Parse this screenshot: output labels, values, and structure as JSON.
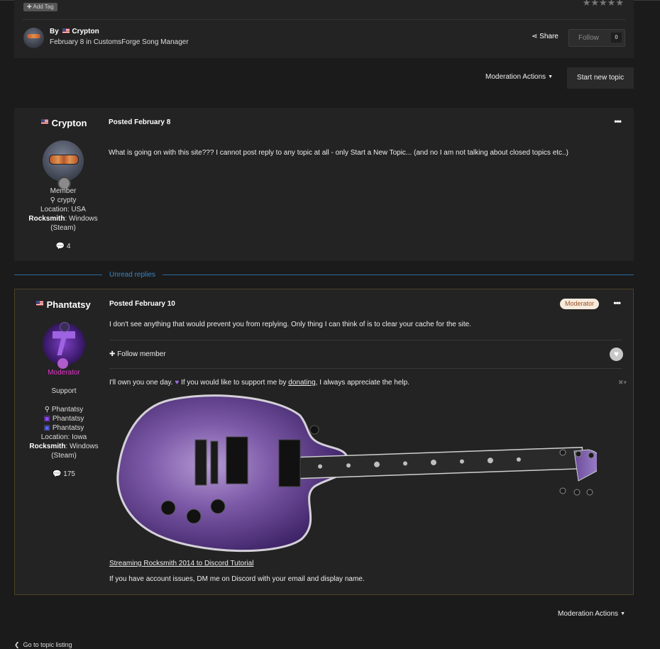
{
  "topic_header": {
    "add_tag": "Add Tag",
    "stars": "★★★★★",
    "by_label": "By",
    "author": "Crypton",
    "date_forum": "February 8 in CustomsForge Song Manager",
    "share": "Share",
    "follow": "Follow",
    "follow_count": "0"
  },
  "actions": {
    "moderation": "Moderation Actions",
    "start_new_topic": "Start new topic"
  },
  "post1": {
    "username": "Crypton",
    "role": "Member",
    "platform_user": "crypty",
    "location": "Location: USA",
    "rocksmith_label": "Rocksmith",
    "rocksmith_value": ": Windows (Steam)",
    "post_count": "4",
    "posted": "Posted February 8",
    "menu": "•••",
    "content": "What is going on with this site??? I cannot post reply to any topic at all - only Start a New Topic... (and no I am not talking about closed topics etc..)"
  },
  "unread": "Unread replies",
  "post2": {
    "username": "Phantatsy",
    "role": "Moderator",
    "group": "Support",
    "accounts": [
      "Phantatsy",
      "Phantatsy",
      "Phantatsy"
    ],
    "location": "Location: Iowa",
    "rocksmith_label": "Rocksmith",
    "rocksmith_value": ": Windows (Steam)",
    "post_count": "175",
    "posted": "Posted February 10",
    "badge": "Moderator",
    "menu": "•••",
    "content": "I don't see anything that would prevent you from replying. Only thing I can think of is to clear your cache for the site.",
    "follow_member": "Follow member",
    "sig_line_a": "I'll own you one day.",
    "sig_line_b": "If you would like to support me by",
    "sig_link": "donating",
    "sig_line_c": ", I always appreciate the help.",
    "stream_link": "Streaming Rocksmith 2014 to Discord Tutorial",
    "account_issues": "If you have account issues, DM me on Discord with your email and display name."
  },
  "footer": {
    "moderation": "Moderation Actions",
    "go_to": "Go to topic listing"
  },
  "colors": {
    "background": "#1b1b1b",
    "panel": "#232323",
    "accent_blue": "#3a86c4",
    "moderator_pink": "#e036c8",
    "mod_pill_bg": "#f6eadd"
  }
}
